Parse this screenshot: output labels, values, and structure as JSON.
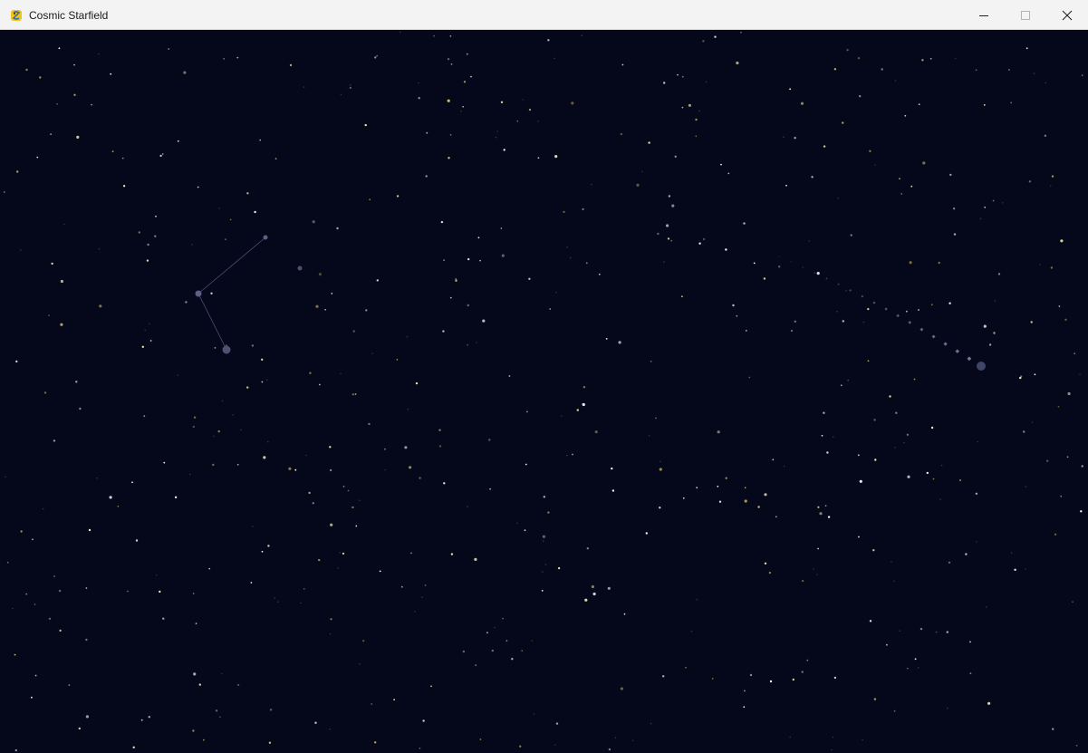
{
  "window": {
    "title": "Cosmic Starfield",
    "controls": [
      "minimize",
      "maximize",
      "close"
    ],
    "icons": {
      "app": "pygame-snake-icon",
      "minimize": "minimize-icon",
      "maximize": "maximize-icon",
      "close": "close-icon"
    }
  },
  "colors": {
    "background": "#05071a",
    "star_white": "#ffffff",
    "star_yellow": "#f2e6a6",
    "star_gold": "#d8c06a",
    "constellation_line": "#4a5070",
    "comet": "#8c93a8"
  }
}
